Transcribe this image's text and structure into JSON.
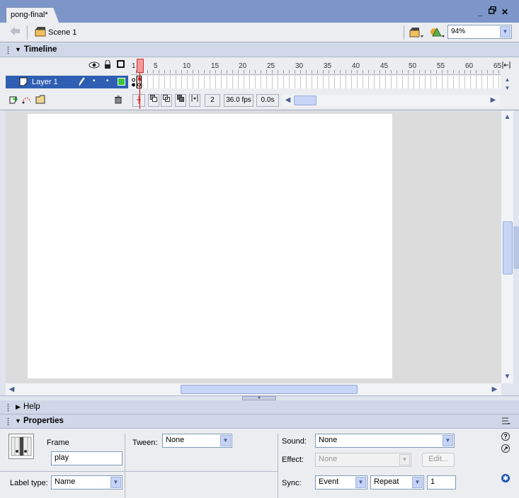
{
  "document": {
    "tab_title": "pong-final*"
  },
  "window_controls": {
    "minimize": "_",
    "restore": "▫",
    "close": "✕"
  },
  "edit_bar": {
    "scene_label": "Scene 1",
    "zoom_value": "94%"
  },
  "timeline": {
    "title": "Timeline",
    "ruler_ticks": [
      "1",
      "5",
      "10",
      "15",
      "20",
      "25",
      "30",
      "35",
      "40",
      "45",
      "50",
      "55",
      "60",
      "65"
    ],
    "layer_name": "Layer 1",
    "current_frame": "2",
    "frame_rate": "36.0 fps",
    "elapsed_time": "0.0s"
  },
  "help_panel": {
    "title": "Help"
  },
  "properties": {
    "title": "Properties",
    "frame_label": "Frame",
    "frame_name_value": "play",
    "label_type_label": "Label type:",
    "label_type_value": "Name",
    "tween_label": "Tween:",
    "tween_value": "None",
    "sound_label": "Sound:",
    "sound_value": "None",
    "effect_label": "Effect:",
    "effect_value": "None",
    "edit_button": "Edit...",
    "sync_label": "Sync:",
    "sync_value": "Event",
    "repeat_value": "Repeat",
    "repeat_count": "1"
  },
  "colors": {
    "titlebar": "#7d96c9",
    "selection": "#2f5fb3",
    "playhead": "#f49a9a",
    "layer_outline": "#39c639"
  }
}
